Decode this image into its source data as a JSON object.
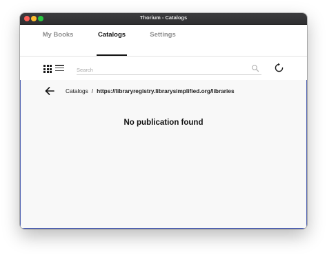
{
  "window": {
    "title": "Thorium - Catalogs"
  },
  "tabs": [
    {
      "label": "My Books",
      "active": false
    },
    {
      "label": "Catalogs",
      "active": true
    },
    {
      "label": "Settings",
      "active": false
    }
  ],
  "toolbar": {
    "view_modes": [
      "grid-icon",
      "list-icon"
    ],
    "search": {
      "placeholder": "Search",
      "value": ""
    },
    "refresh_icon": "refresh-icon"
  },
  "breadcrumb": {
    "root": "Catalogs",
    "separator": "/",
    "current": "https://libraryregistry.librarysimplified.org/libraries"
  },
  "main": {
    "empty_message": "No publication found"
  },
  "colors": {
    "accent_border": "#4e60b0",
    "title_bar": "#333335"
  }
}
